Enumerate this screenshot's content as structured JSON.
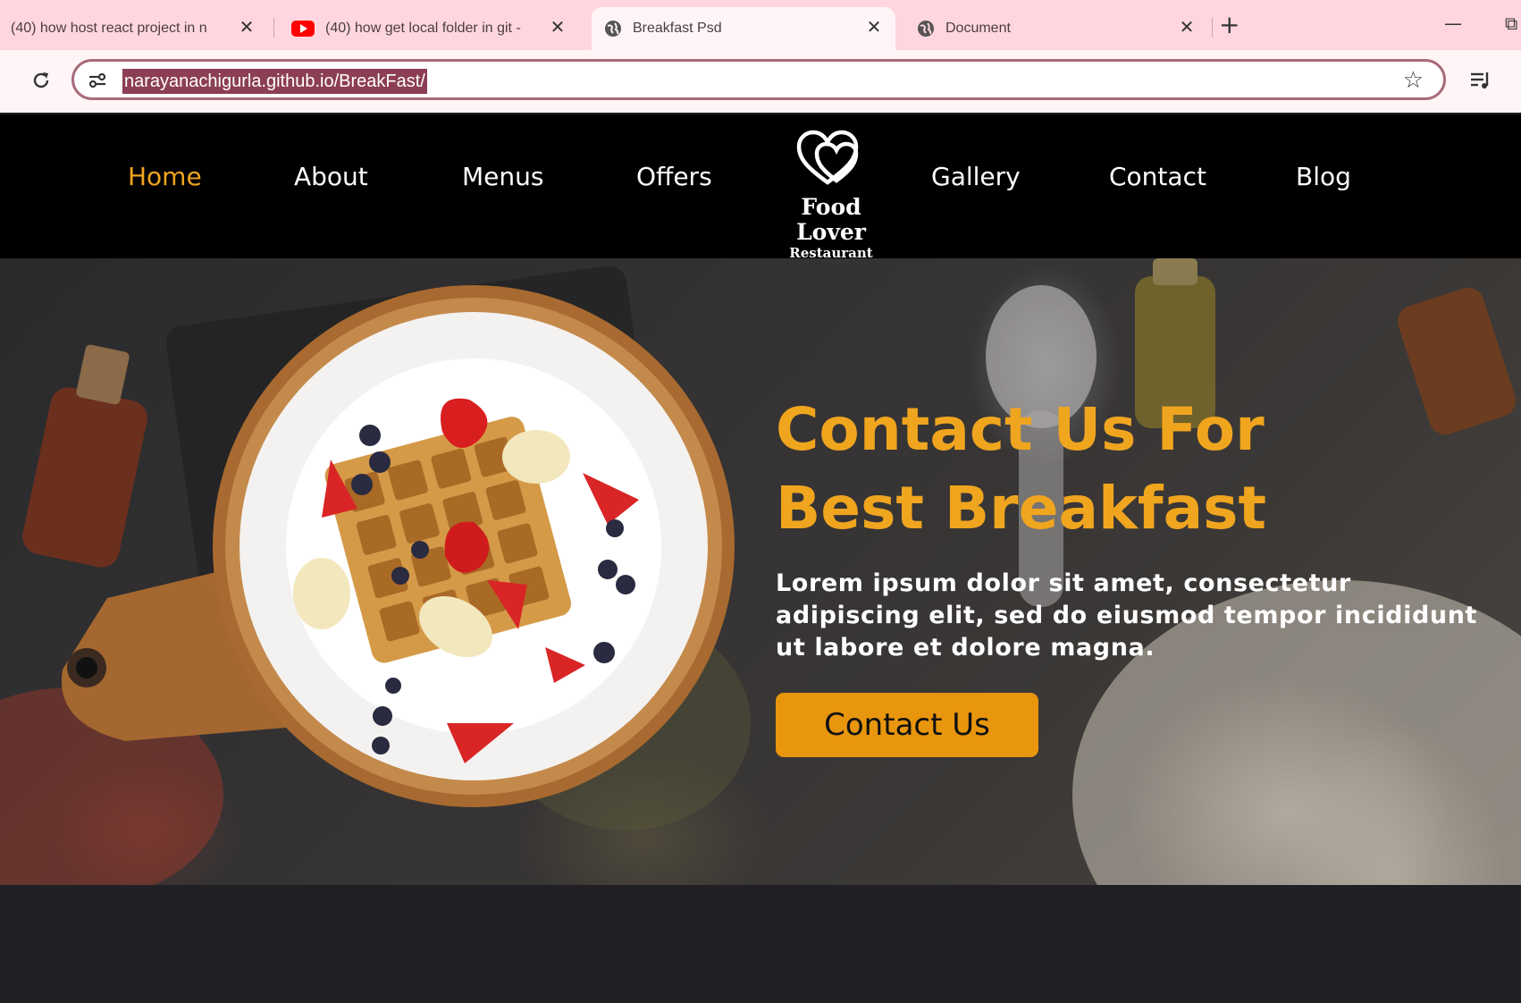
{
  "browser": {
    "tabs": [
      {
        "title": "(40) how host react project in n",
        "favicon": "none",
        "active": false
      },
      {
        "title": "(40) how get local folder in git -",
        "favicon": "youtube-icon",
        "active": false
      },
      {
        "title": "Breakfast Psd",
        "favicon": "globe-icon",
        "active": true
      },
      {
        "title": "Document",
        "favicon": "globe-icon",
        "active": false
      }
    ],
    "close_glyph": "✕",
    "new_tab_glyph": "+",
    "minimize_glyph": "—",
    "restore_glyph": "⧉",
    "url": "narayanachigurla.github.io/BreakFast/",
    "bookmark_glyph": "☆"
  },
  "nav": {
    "left_links": [
      "Home",
      "About",
      "Menus",
      "Offers"
    ],
    "right_links": [
      "Gallery",
      "Contact",
      "Blog"
    ],
    "active": "Home",
    "active_color": "#f0a51f"
  },
  "logo": {
    "icon": "double-heart-icon",
    "name": "Food Lover",
    "subtitle": "Restaurant"
  },
  "hero": {
    "title_line1": "Contact Us For",
    "title_line2": "Best Breakfast",
    "text": "Lorem ipsum dolor sit amet, consectetur adipiscing elit, sed do eiusmod tempor incididunt ut labore et dolore magna.",
    "button_label": "Contact Us",
    "accent_color": "#f0a51f",
    "button_color": "#e8960d",
    "image_subject": "waffles-plate-icon"
  }
}
